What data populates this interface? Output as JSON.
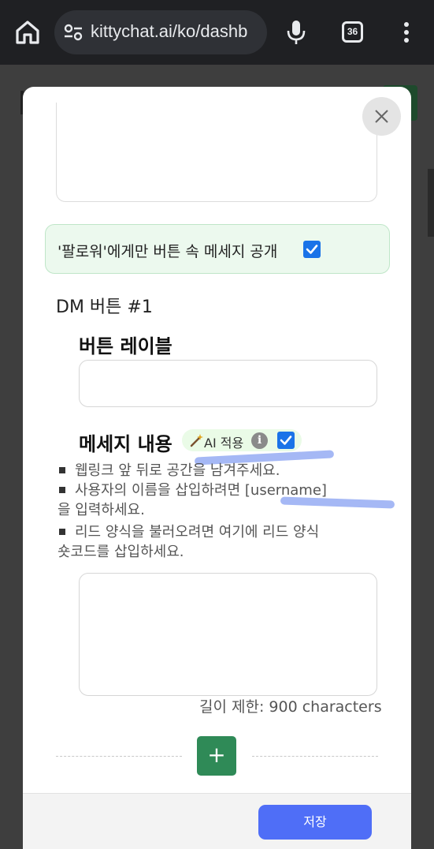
{
  "browser": {
    "url": "kittychat.ai/ko/dashb",
    "tab_count": "36"
  },
  "modal": {
    "follower_only_label": "'팔로워'에게만 버튼 속 메세지 공개",
    "follower_only_checked": true,
    "dm_button_title": "DM 버튼 #1",
    "button_label_title": "버튼 레이블",
    "button_label_value": "",
    "message_title": "메세지 내용",
    "ai_badge_label": "AI 적용",
    "ai_info_glyph": "i",
    "ai_checked": true,
    "hints": [
      "웹링크 앞 뒤로 공간을 남겨주세요.",
      "사용자의 이름을 삽입하려면 [username]",
      "을 입력하세요.",
      "리드 양식을 불러오려면 여기에 리드 양식",
      "숏코드를 삽입하세요."
    ],
    "message_value": "",
    "char_limit": "길이 제한: 900 characters",
    "add_button": "+",
    "save_button": "저장"
  },
  "colors": {
    "accent_blue": "#4f6ef7",
    "add_green": "#2f8a57",
    "checkbox_blue": "#1a73e8",
    "follower_bg": "#ecf9ee"
  },
  "icons": [
    "home-icon",
    "site-settings-icon",
    "mic-icon",
    "tab-switcher-icon",
    "more-menu-icon",
    "close-icon",
    "checkmark-icon",
    "magic-wand-icon",
    "info-icon",
    "plus-icon"
  ]
}
